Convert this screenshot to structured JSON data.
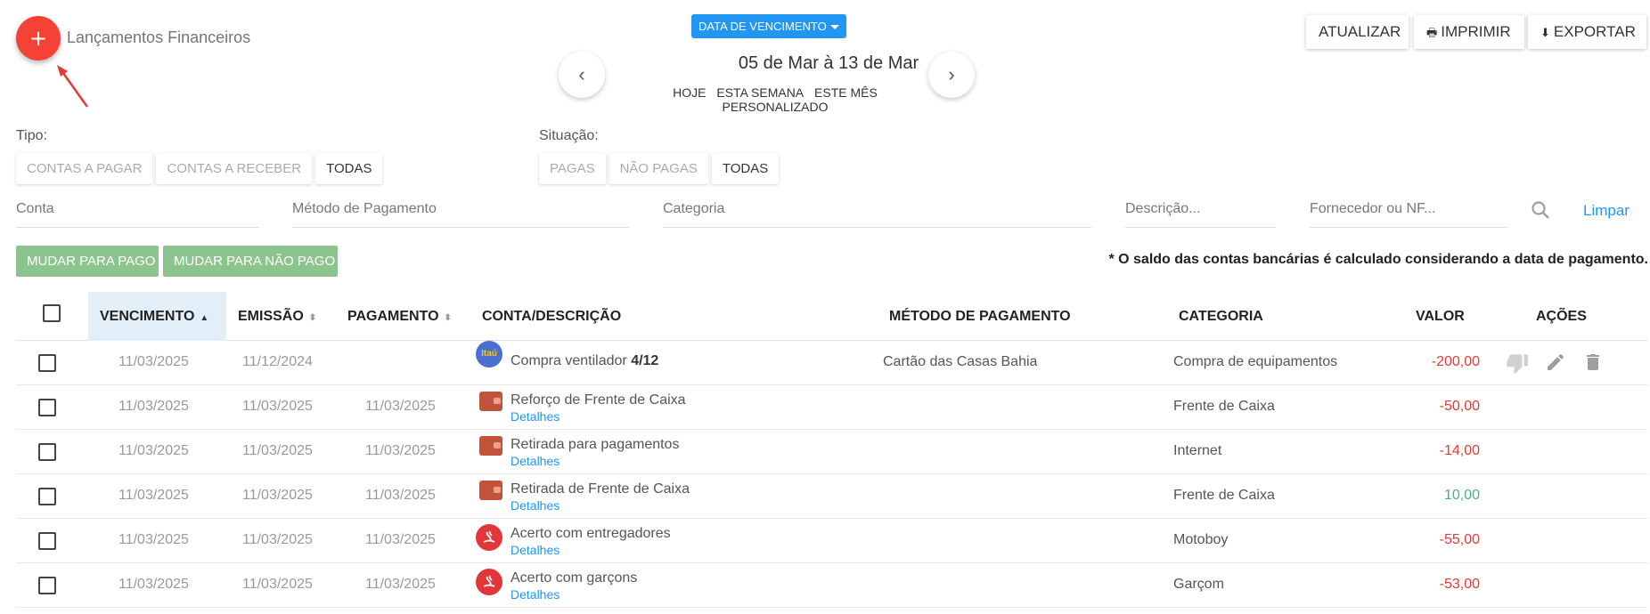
{
  "header": {
    "add_button": "+",
    "title": "Lançamentos Financeiros",
    "date_filter": "DATA DE VENCIMENTO",
    "date_range": "05 de Mar à 13 de Mar",
    "prev_icon": "‹",
    "next_icon": "›",
    "periods": [
      "HOJE",
      "ESTA SEMANA",
      "ESTE MÊS",
      "PERSONALIZADO"
    ]
  },
  "toolbar": {
    "refresh": "ATUALIZAR",
    "print": "IMPRIMIR",
    "export": "EXPORTAR"
  },
  "filters": {
    "tipo_label": "Tipo:",
    "tipo_options": [
      "CONTAS A PAGAR",
      "CONTAS A RECEBER",
      "TODAS"
    ],
    "situacao_label": "Situação:",
    "situacao_options": [
      "PAGAS",
      "NÃO PAGAS",
      "TODAS"
    ],
    "conta": "Conta",
    "metodo": "Método de Pagamento",
    "categoria": "Categoria",
    "descricao": "Descrição...",
    "fornecedor": "Fornecedor ou NF...",
    "clear": "Limpar"
  },
  "actions": {
    "mark_paid": "MUDAR PARA PAGO",
    "mark_unpaid": "MUDAR PARA NÃO PAGO",
    "note": "* O saldo das contas bancárias é calculado considerando a data de pagamento."
  },
  "table": {
    "headers": {
      "vencimento": "VENCIMENTO",
      "emissao": "EMISSÃO",
      "pagamento": "PAGAMENTO",
      "conta": "CONTA/DESCRIÇÃO",
      "metodo": "MÉTODO DE PAGAMENTO",
      "categoria": "CATEGORIA",
      "valor": "VALOR",
      "acoes": "AÇÕES"
    },
    "details_label": "Detalhes",
    "rows": [
      {
        "vencimento": "11/03/2025",
        "emissao": "11/12/2024",
        "pagamento": "",
        "account_icon": "itau-icon",
        "account_text": "Itaú",
        "descricao": "Compra ventilador",
        "parcela": "4/12",
        "metodo": "Cartão das Casas Bahia",
        "categoria": "Compra de equipamentos",
        "valor": "-200,00"
      },
      {
        "vencimento": "11/03/2025",
        "emissao": "11/03/2025",
        "pagamento": "11/03/2025",
        "account_icon": "wallet-icon",
        "descricao": "Reforço de Frente de Caixa",
        "metodo": "",
        "categoria": "Frente de Caixa",
        "valor": "-50,00"
      },
      {
        "vencimento": "11/03/2025",
        "emissao": "11/03/2025",
        "pagamento": "11/03/2025",
        "account_icon": "wallet-icon",
        "descricao": "Retirada para pagamentos",
        "metodo": "",
        "categoria": "Internet",
        "valor": "-14,00"
      },
      {
        "vencimento": "11/03/2025",
        "emissao": "11/03/2025",
        "pagamento": "11/03/2025",
        "account_icon": "wallet-icon",
        "descricao": "Retirada de Frente de Caixa",
        "metodo": "",
        "categoria": "Frente de Caixa",
        "valor": "10,00"
      },
      {
        "vencimento": "11/03/2025",
        "emissao": "11/03/2025",
        "pagamento": "11/03/2025",
        "account_icon": "santander-icon",
        "descricao": "Acerto com entregadores",
        "metodo": "",
        "categoria": "Motoboy",
        "valor": "-55,00"
      },
      {
        "vencimento": "11/03/2025",
        "emissao": "11/03/2025",
        "pagamento": "11/03/2025",
        "account_icon": "santander-icon",
        "descricao": "Acerto com garçons",
        "metodo": "",
        "categoria": "Garçom",
        "valor": "-53,00"
      }
    ]
  },
  "colors": {
    "fab": "#f44336",
    "primary": "#2196f3",
    "green_button": "#8bc58d",
    "negative": "#e53935",
    "positive": "#4caf88"
  }
}
